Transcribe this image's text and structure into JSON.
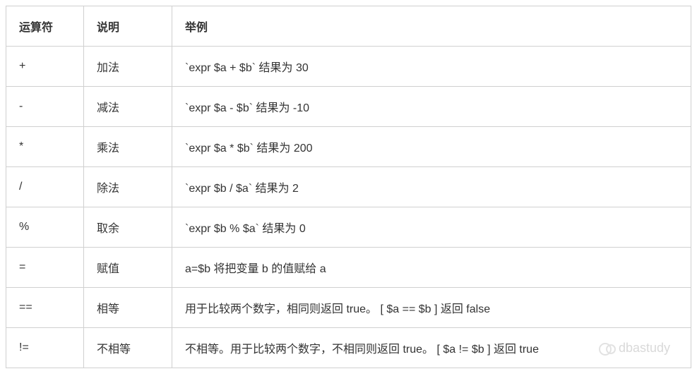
{
  "table": {
    "headers": {
      "operator": "运算符",
      "description": "说明",
      "example": "举例"
    },
    "rows": [
      {
        "operator": "+",
        "description": "加法",
        "example": "`expr $a + $b` 结果为 30"
      },
      {
        "operator": "-",
        "description": "减法",
        "example": "`expr $a - $b` 结果为 -10"
      },
      {
        "operator": "*",
        "description": "乘法",
        "example": "`expr $a * $b` 结果为  200"
      },
      {
        "operator": "/",
        "description": "除法",
        "example": "`expr $b / $a` 结果为 2"
      },
      {
        "operator": "%",
        "description": "取余",
        "example": "`expr $b % $a` 结果为 0"
      },
      {
        "operator": "=",
        "description": "赋值",
        "example": "a=$b 将把变量 b 的值赋给 a"
      },
      {
        "operator": "==",
        "description": "相等",
        "example": "用于比较两个数字，相同则返回 true。 [ $a == $b ] 返回 false"
      },
      {
        "operator": "!=",
        "description": "不相等",
        "example": "不相等。用于比较两个数字，不相同则返回 true。 [ $a != $b ] 返回 true"
      }
    ]
  },
  "watermark": {
    "text": "dbastudy"
  }
}
